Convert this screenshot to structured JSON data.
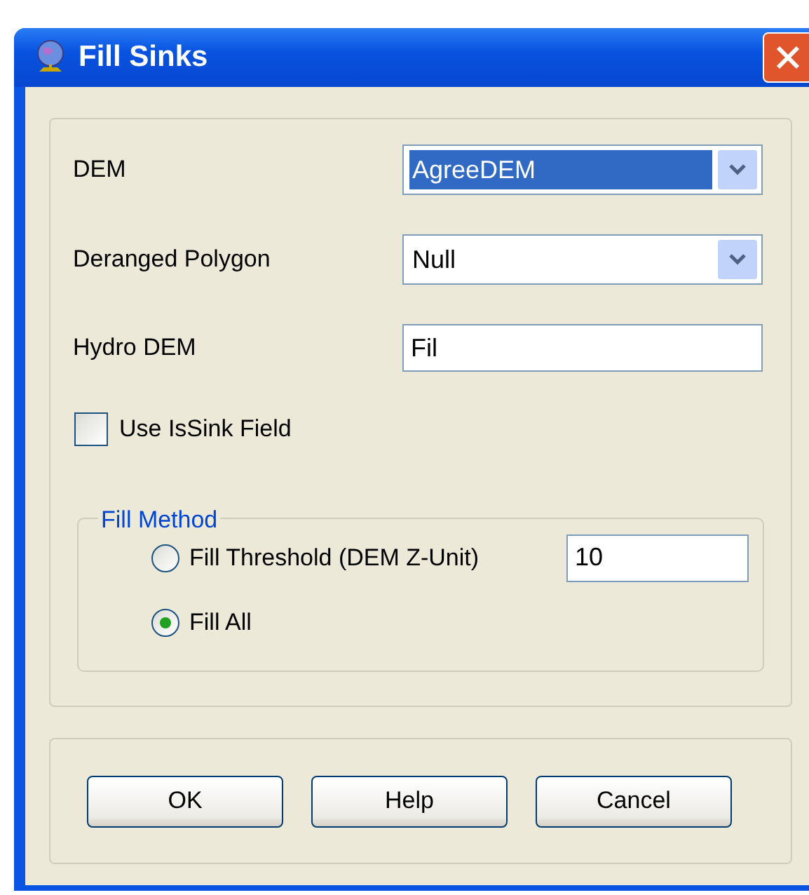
{
  "window": {
    "title": "Fill Sinks"
  },
  "fields": [
    {
      "kind": "dropdown",
      "label": "DEM",
      "value": "AgreeDEM",
      "selected": true
    },
    {
      "kind": "dropdown",
      "label": "Deranged Polygon",
      "value": "Null",
      "selected": false
    },
    {
      "kind": "text",
      "label": "Hydro DEM",
      "value": "Fil"
    }
  ],
  "use_issink": {
    "label": "Use IsSink Field",
    "checked": false
  },
  "fill_method": {
    "title": "Fill Method",
    "options": [
      {
        "label": "Fill Threshold (DEM Z-Unit)",
        "selected": false,
        "value": "10"
      },
      {
        "label": "Fill All",
        "selected": true
      }
    ]
  },
  "buttons": [
    "OK",
    "Help",
    "Cancel"
  ]
}
